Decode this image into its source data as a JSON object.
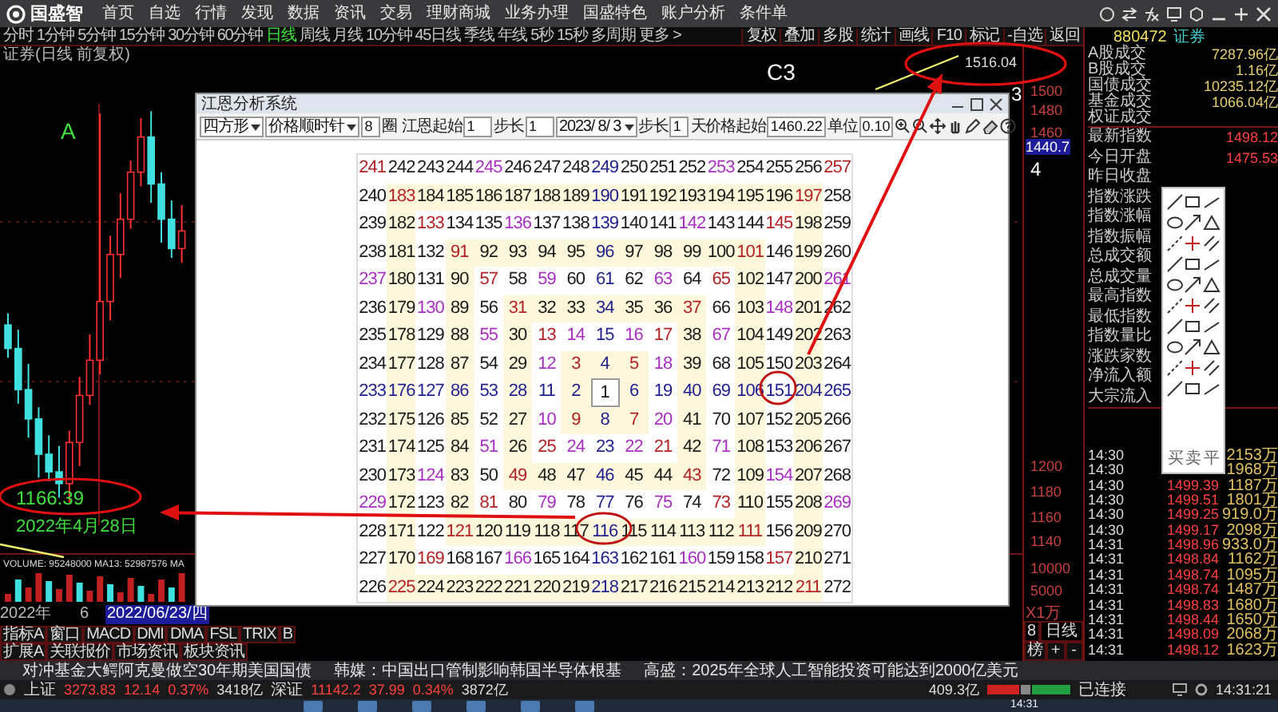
{
  "menubar": {
    "logo": "国盛智",
    "items": [
      "首页",
      "自选",
      "行情",
      "发现",
      "数据",
      "资讯",
      "交易",
      "理财商城",
      "业务办理",
      "国盛特色",
      "账户分析",
      "条件单"
    ]
  },
  "period_bar": {
    "tabs": [
      {
        "label": "分时",
        "selected": false
      },
      {
        "label": "1分钟",
        "selected": false
      },
      {
        "label": "5分钟",
        "selected": false
      },
      {
        "label": "15分钟",
        "selected": false
      },
      {
        "label": "30分钟",
        "selected": false
      },
      {
        "label": "60分钟",
        "selected": false
      },
      {
        "label": "日线",
        "selected": true
      },
      {
        "label": "周线",
        "selected": false
      },
      {
        "label": "月线",
        "selected": false
      },
      {
        "label": "10分钟",
        "selected": false
      },
      {
        "label": "45日线",
        "selected": false
      },
      {
        "label": "季线",
        "selected": false
      },
      {
        "label": "年线",
        "selected": false
      },
      {
        "label": "5秒",
        "selected": false
      },
      {
        "label": "15秒",
        "selected": false
      },
      {
        "label": "多周期",
        "selected": false
      },
      {
        "label": "更多 >",
        "selected": false
      }
    ],
    "tools": [
      "复权",
      "叠加",
      "多股",
      "统计",
      "画线",
      "F10",
      "标记",
      "-自选",
      "返回"
    ]
  },
  "chart": {
    "title": "证券(日线 前复权)",
    "wave_a": "A",
    "wave_c3": "C3",
    "wave_3": "3",
    "peak_price": "1516.04",
    "low_price": "1166.39",
    "low_date": "2022年4月28日",
    "volume_info": "VOLUME: 95248000  MA13: 52987576  MA",
    "year": "2022年",
    "month": "6",
    "cursor_date": "2022/06/23/四",
    "indicator_tabs": [
      "指标A",
      "窗口",
      "MACD",
      "DMI",
      "DMA",
      "FSL",
      "TRIX",
      "B"
    ],
    "extra_tabs": [
      "扩展A",
      "关联报价",
      "市场资讯",
      "板块资讯"
    ]
  },
  "price_axis": {
    "labels": [
      "1500",
      "1480",
      "1460"
    ],
    "cursor_price": "1440.7",
    "wave_4": "4",
    "lower_labels": [
      "1200",
      "1180",
      "1160",
      "1140"
    ],
    "volume_labels": [
      "10000",
      "5000"
    ],
    "volume_unit": "X1万",
    "period_number": "8",
    "period_label": "日线",
    "controls": [
      "榜",
      "+",
      "-"
    ]
  },
  "dialog": {
    "title": "江恩分析系统",
    "shape": "四方形",
    "direction": "价格顺时针",
    "circles": "8",
    "circle_unit": "圈",
    "start_label": "江恩起始",
    "start": "1",
    "step_label": "步长",
    "step": "1",
    "date": "2023/ 8/ 3",
    "day_step_label": "步长",
    "day_step": "1",
    "price_start_label": "天价格起始",
    "price_start": "1460.22",
    "unit_label": "单位",
    "unit": "0.10",
    "grid": [
      [
        {
          "n": "241",
          "color": "#b22222"
        },
        {
          "n": "242"
        },
        {
          "n": "243"
        },
        {
          "n": "244"
        },
        {
          "n": "245",
          "color": "#a82fc0"
        },
        {
          "n": "246"
        },
        {
          "n": "247"
        },
        {
          "n": "248"
        },
        {
          "n": "249",
          "color": "#1f1f8f"
        },
        {
          "n": "250"
        },
        {
          "n": "251"
        },
        {
          "n": "252"
        },
        {
          "n": "253",
          "color": "#a82fc0"
        },
        {
          "n": "254"
        },
        {
          "n": "255"
        },
        {
          "n": "256"
        },
        {
          "n": "257",
          "color": "#b22222"
        }
      ],
      [
        {
          "n": "240"
        },
        {
          "n": "183",
          "color": "#b22222"
        },
        {
          "n": "184"
        },
        {
          "n": "185"
        },
        {
          "n": "186"
        },
        {
          "n": "187"
        },
        {
          "n": "188"
        },
        {
          "n": "189"
        },
        {
          "n": "190",
          "color": "#1f1f8f"
        },
        {
          "n": "191"
        },
        {
          "n": "192"
        },
        {
          "n": "193"
        },
        {
          "n": "194"
        },
        {
          "n": "195"
        },
        {
          "n": "196"
        },
        {
          "n": "197",
          "color": "#b22222"
        },
        {
          "n": "258"
        }
      ],
      [
        {
          "n": "239"
        },
        {
          "n": "182"
        },
        {
          "n": "133",
          "color": "#b22222"
        },
        {
          "n": "134"
        },
        {
          "n": "135"
        },
        {
          "n": "136",
          "color": "#a82fc0"
        },
        {
          "n": "137"
        },
        {
          "n": "138"
        },
        {
          "n": "139",
          "color": "#1f1f8f"
        },
        {
          "n": "140"
        },
        {
          "n": "141"
        },
        {
          "n": "142",
          "color": "#a82fc0"
        },
        {
          "n": "143"
        },
        {
          "n": "144"
        },
        {
          "n": "145",
          "color": "#b22222"
        },
        {
          "n": "198"
        },
        {
          "n": "259"
        }
      ],
      [
        {
          "n": "238"
        },
        {
          "n": "181"
        },
        {
          "n": "132"
        },
        {
          "n": "91",
          "color": "#b22222"
        },
        {
          "n": "92"
        },
        {
          "n": "93"
        },
        {
          "n": "94"
        },
        {
          "n": "95"
        },
        {
          "n": "96",
          "color": "#1f1f8f"
        },
        {
          "n": "97"
        },
        {
          "n": "98"
        },
        {
          "n": "99"
        },
        {
          "n": "100"
        },
        {
          "n": "101",
          "color": "#b22222"
        },
        {
          "n": "146"
        },
        {
          "n": "199"
        },
        {
          "n": "260"
        }
      ],
      [
        {
          "n": "237",
          "color": "#a82fc0"
        },
        {
          "n": "180"
        },
        {
          "n": "131"
        },
        {
          "n": "90"
        },
        {
          "n": "57",
          "color": "#b22222"
        },
        {
          "n": "58"
        },
        {
          "n": "59",
          "color": "#a82fc0"
        },
        {
          "n": "60"
        },
        {
          "n": "61",
          "color": "#1f1f8f"
        },
        {
          "n": "62"
        },
        {
          "n": "63",
          "color": "#a82fc0"
        },
        {
          "n": "64"
        },
        {
          "n": "65",
          "color": "#b22222"
        },
        {
          "n": "102"
        },
        {
          "n": "147"
        },
        {
          "n": "200"
        },
        {
          "n": "261",
          "color": "#a82fc0"
        }
      ],
      [
        {
          "n": "236"
        },
        {
          "n": "179"
        },
        {
          "n": "130",
          "color": "#a82fc0"
        },
        {
          "n": "89"
        },
        {
          "n": "56"
        },
        {
          "n": "31",
          "color": "#b22222"
        },
        {
          "n": "32"
        },
        {
          "n": "33"
        },
        {
          "n": "34",
          "color": "#1f1f8f"
        },
        {
          "n": "35"
        },
        {
          "n": "36"
        },
        {
          "n": "37",
          "color": "#b22222"
        },
        {
          "n": "66"
        },
        {
          "n": "103"
        },
        {
          "n": "148",
          "color": "#a82fc0"
        },
        {
          "n": "201"
        },
        {
          "n": "262"
        }
      ],
      [
        {
          "n": "235"
        },
        {
          "n": "178"
        },
        {
          "n": "129"
        },
        {
          "n": "88"
        },
        {
          "n": "55",
          "color": "#a82fc0"
        },
        {
          "n": "30"
        },
        {
          "n": "13",
          "color": "#b22222"
        },
        {
          "n": "14",
          "color": "#a82fc0"
        },
        {
          "n": "15",
          "color": "#1f1f8f"
        },
        {
          "n": "16",
          "color": "#a82fc0"
        },
        {
          "n": "17",
          "color": "#b22222"
        },
        {
          "n": "38"
        },
        {
          "n": "67",
          "color": "#a82fc0"
        },
        {
          "n": "104"
        },
        {
          "n": "149"
        },
        {
          "n": "202"
        },
        {
          "n": "263"
        }
      ],
      [
        {
          "n": "234"
        },
        {
          "n": "177"
        },
        {
          "n": "128"
        },
        {
          "n": "87"
        },
        {
          "n": "54"
        },
        {
          "n": "29"
        },
        {
          "n": "12",
          "color": "#a82fc0"
        },
        {
          "n": "3",
          "color": "#b22222"
        },
        {
          "n": "4",
          "color": "#1f1f8f"
        },
        {
          "n": "5",
          "color": "#b22222"
        },
        {
          "n": "18",
          "color": "#a82fc0"
        },
        {
          "n": "39"
        },
        {
          "n": "68"
        },
        {
          "n": "105"
        },
        {
          "n": "150"
        },
        {
          "n": "203"
        },
        {
          "n": "264"
        }
      ],
      [
        {
          "n": "233",
          "color": "#1f1f8f"
        },
        {
          "n": "176",
          "color": "#1f1f8f"
        },
        {
          "n": "127",
          "color": "#1f1f8f"
        },
        {
          "n": "86",
          "color": "#1f1f8f"
        },
        {
          "n": "53",
          "color": "#1f1f8f"
        },
        {
          "n": "28",
          "color": "#1f1f8f"
        },
        {
          "n": "11",
          "color": "#1f1f8f"
        },
        {
          "n": "2",
          "color": "#1f1f8f"
        },
        {
          "n": "1"
        },
        {
          "n": "6",
          "color": "#1f1f8f"
        },
        {
          "n": "19",
          "color": "#1f1f8f"
        },
        {
          "n": "40",
          "color": "#1f1f8f"
        },
        {
          "n": "69",
          "color": "#1f1f8f"
        },
        {
          "n": "106",
          "color": "#1f1f8f"
        },
        {
          "n": "151",
          "color": "#1f1f8f"
        },
        {
          "n": "204",
          "color": "#1f1f8f"
        },
        {
          "n": "265",
          "color": "#1f1f8f"
        }
      ],
      [
        {
          "n": "232"
        },
        {
          "n": "175"
        },
        {
          "n": "126"
        },
        {
          "n": "85"
        },
        {
          "n": "52"
        },
        {
          "n": "27"
        },
        {
          "n": "10",
          "color": "#a82fc0"
        },
        {
          "n": "9",
          "color": "#b22222"
        },
        {
          "n": "8",
          "color": "#1f1f8f"
        },
        {
          "n": "7",
          "color": "#b22222"
        },
        {
          "n": "20",
          "color": "#a82fc0"
        },
        {
          "n": "41"
        },
        {
          "n": "70"
        },
        {
          "n": "107"
        },
        {
          "n": "152"
        },
        {
          "n": "205"
        },
        {
          "n": "266"
        }
      ],
      [
        {
          "n": "231"
        },
        {
          "n": "174"
        },
        {
          "n": "125"
        },
        {
          "n": "84"
        },
        {
          "n": "51",
          "color": "#a82fc0"
        },
        {
          "n": "26"
        },
        {
          "n": "25",
          "color": "#b22222"
        },
        {
          "n": "24",
          "color": "#a82fc0"
        },
        {
          "n": "23",
          "color": "#1f1f8f"
        },
        {
          "n": "22",
          "color": "#a82fc0"
        },
        {
          "n": "21",
          "color": "#b22222"
        },
        {
          "n": "42"
        },
        {
          "n": "71",
          "color": "#a82fc0"
        },
        {
          "n": "108"
        },
        {
          "n": "153"
        },
        {
          "n": "206"
        },
        {
          "n": "267"
        }
      ],
      [
        {
          "n": "230"
        },
        {
          "n": "173"
        },
        {
          "n": "124",
          "color": "#a82fc0"
        },
        {
          "n": "83"
        },
        {
          "n": "50"
        },
        {
          "n": "49",
          "color": "#b22222"
        },
        {
          "n": "48"
        },
        {
          "n": "47"
        },
        {
          "n": "46",
          "color": "#1f1f8f"
        },
        {
          "n": "45"
        },
        {
          "n": "44"
        },
        {
          "n": "43",
          "color": "#b22222"
        },
        {
          "n": "72"
        },
        {
          "n": "109"
        },
        {
          "n": "154",
          "color": "#a82fc0"
        },
        {
          "n": "207"
        },
        {
          "n": "268"
        }
      ],
      [
        {
          "n": "229",
          "color": "#a82fc0"
        },
        {
          "n": "172"
        },
        {
          "n": "123"
        },
        {
          "n": "82"
        },
        {
          "n": "81",
          "color": "#b22222"
        },
        {
          "n": "80"
        },
        {
          "n": "79",
          "color": "#a82fc0"
        },
        {
          "n": "78"
        },
        {
          "n": "77",
          "color": "#1f1f8f"
        },
        {
          "n": "76"
        },
        {
          "n": "75",
          "color": "#a82fc0"
        },
        {
          "n": "74"
        },
        {
          "n": "73",
          "color": "#b22222"
        },
        {
          "n": "110"
        },
        {
          "n": "155"
        },
        {
          "n": "208"
        },
        {
          "n": "269",
          "color": "#a82fc0"
        }
      ],
      [
        {
          "n": "228"
        },
        {
          "n": "171"
        },
        {
          "n": "122"
        },
        {
          "n": "121",
          "color": "#b22222"
        },
        {
          "n": "120"
        },
        {
          "n": "119"
        },
        {
          "n": "118"
        },
        {
          "n": "117"
        },
        {
          "n": "116",
          "color": "#1f1f8f"
        },
        {
          "n": "115"
        },
        {
          "n": "114"
        },
        {
          "n": "113"
        },
        {
          "n": "112"
        },
        {
          "n": "111",
          "color": "#b22222"
        },
        {
          "n": "156"
        },
        {
          "n": "209"
        },
        {
          "n": "270"
        }
      ],
      [
        {
          "n": "227"
        },
        {
          "n": "170"
        },
        {
          "n": "169",
          "color": "#b22222"
        },
        {
          "n": "168"
        },
        {
          "n": "167"
        },
        {
          "n": "166",
          "color": "#a82fc0"
        },
        {
          "n": "165"
        },
        {
          "n": "164"
        },
        {
          "n": "163",
          "color": "#1f1f8f"
        },
        {
          "n": "162"
        },
        {
          "n": "161"
        },
        {
          "n": "160",
          "color": "#a82fc0"
        },
        {
          "n": "159"
        },
        {
          "n": "158"
        },
        {
          "n": "157",
          "color": "#b22222"
        },
        {
          "n": "210"
        },
        {
          "n": "271"
        }
      ],
      [
        {
          "n": "226"
        },
        {
          "n": "225",
          "color": "#b22222"
        },
        {
          "n": "224"
        },
        {
          "n": "223"
        },
        {
          "n": "222"
        },
        {
          "n": "221"
        },
        {
          "n": "220"
        },
        {
          "n": "219"
        },
        {
          "n": "218",
          "color": "#1f1f8f"
        },
        {
          "n": "217"
        },
        {
          "n": "216"
        },
        {
          "n": "215"
        },
        {
          "n": "214"
        },
        {
          "n": "213"
        },
        {
          "n": "212"
        },
        {
          "n": "211",
          "color": "#b22222"
        },
        {
          "n": "272"
        }
      ]
    ]
  },
  "quote_panel": {
    "code": "880472",
    "name": "证券",
    "turnover": [
      {
        "label": "A股成交",
        "value": "7287.96亿"
      },
      {
        "label": "B股成交",
        "value": "1.16亿"
      },
      {
        "label": "国债成交",
        "value": "10235.12亿"
      },
      {
        "label": "基金成交",
        "value": "1066.04亿"
      },
      {
        "label": "权证成交"
      }
    ],
    "stats": [
      {
        "label": "最新指数",
        "value": "1498.12"
      },
      {
        "label": "今日开盘",
        "value": "1475.53"
      },
      {
        "label": "昨日收盘"
      },
      {
        "label": "指数涨跌"
      },
      {
        "label": "指数涨幅"
      },
      {
        "label": "指数振幅"
      },
      {
        "label": "总成交额"
      },
      {
        "label": "总成交量"
      },
      {
        "label": "最高指数"
      },
      {
        "label": "最低指数"
      },
      {
        "label": "指数量比"
      },
      {
        "label": "涨跌家数"
      },
      {
        "label": "净流入额"
      },
      {
        "label": "大宗流入"
      }
    ]
  },
  "trades": [
    {
      "time": "14:30",
      "volume": "2153万"
    },
    {
      "time": "14:30",
      "volume": "1968万"
    },
    {
      "time": "14:30",
      "price": "1499.39",
      "volume": "1187万"
    },
    {
      "time": "14:30",
      "price": "1499.51",
      "volume": "1801万"
    },
    {
      "time": "14:30",
      "price": "1499.25",
      "volume": "919.0万"
    },
    {
      "time": "14:30",
      "price": "1499.17",
      "volume": "2098万"
    },
    {
      "time": "14:31",
      "price": "1498.96",
      "volume": "933.0万"
    },
    {
      "time": "14:31",
      "price": "1498.84",
      "volume": "1162万"
    },
    {
      "time": "14:31",
      "price": "1498.74",
      "volume": "1095万"
    },
    {
      "time": "14:31",
      "price": "1498.74",
      "volume": "1487万"
    },
    {
      "time": "14:31",
      "price": "1498.83",
      "volume": "1680万"
    },
    {
      "time": "14:31",
      "price": "1498.44",
      "volume": "1650万"
    },
    {
      "time": "14:31",
      "price": "1498.09",
      "volume": "2068万"
    },
    {
      "time": "14:31",
      "price": "1498.12",
      "volume": "1623万"
    }
  ],
  "drawing_palette": {
    "actions": [
      "买",
      "卖",
      "平"
    ]
  },
  "ticker": [
    "对冲基金大鳄阿克曼做空30年期美国国债",
    "韩媒：中国出口管制影响韩国半导体根基",
    "高盛：2025年全球人工智能投资可能达到2000亿美元"
  ],
  "status_bar": {
    "indices": [
      {
        "name": "上证",
        "price": "3273.83",
        "change": "12.14",
        "percent": "0.37%",
        "amount": "3418亿"
      },
      {
        "name": "深证",
        "price": "11142.2",
        "change": "37.99",
        "percent": "0.34%",
        "amount": "3872亿"
      }
    ],
    "amount": "409.3亿",
    "connection": "已连接",
    "time": "14:31:21"
  },
  "taskbar": {
    "time": "14:31"
  }
}
